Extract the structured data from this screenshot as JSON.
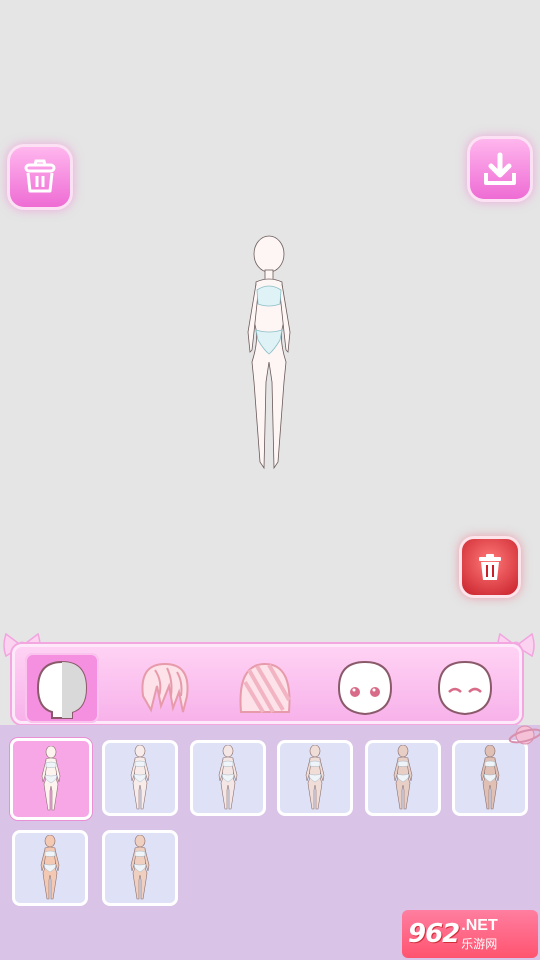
{
  "toolbar": {
    "clear_icon": "clear-outfit-icon",
    "download_icon": "download-icon",
    "delete_icon": "trash-icon"
  },
  "colors": {
    "accent_pink": "#f58fe0",
    "bar_pink": "#ffd2f4",
    "panel_lilac": "#d9c3e6",
    "card_blue": "#dfe2f7",
    "delete_red": "#c8202a"
  },
  "categories": [
    {
      "icon": "body-base-icon",
      "active": true
    },
    {
      "icon": "hair-front-icon",
      "active": false
    },
    {
      "icon": "hair-back-icon",
      "active": false
    },
    {
      "icon": "face-eyes-open-icon",
      "active": false
    },
    {
      "icon": "face-eyes-closed-icon",
      "active": false
    }
  ],
  "skin_options": [
    {
      "tone": "#fdf4f0",
      "selected": true
    },
    {
      "tone": "#f8ecea",
      "selected": false
    },
    {
      "tone": "#f3e6e4",
      "selected": false
    },
    {
      "tone": "#f0ddd8",
      "selected": false
    },
    {
      "tone": "#e8cfc6",
      "selected": false
    },
    {
      "tone": "#e0c0b4",
      "selected": false
    },
    {
      "tone": "#f3c9b3",
      "selected": false
    },
    {
      "tone": "#efcfc0",
      "selected": false
    }
  ],
  "watermark": {
    "number": "962",
    "net": ".NET",
    "site": "乐游网"
  }
}
